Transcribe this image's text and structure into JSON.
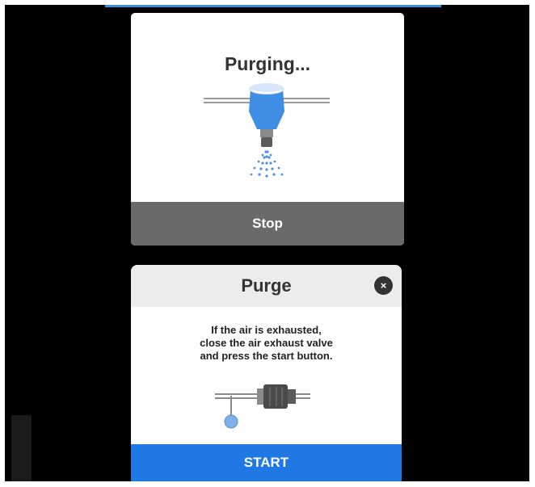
{
  "purging_dialog": {
    "title": "Purging...",
    "stop_label": "Stop",
    "icon": "spray-nozzle-icon"
  },
  "purge_dialog": {
    "title": "Purge",
    "close_glyph": "×",
    "message_lines": [
      "If the air is exhausted,",
      "close the air exhaust valve",
      "and press the start button."
    ],
    "icon": "air-exhaust-valve-icon",
    "start_label": "START"
  },
  "colors": {
    "background": "#000000",
    "accent_blue": "#1f78e3",
    "stop_gray": "#6a6a6a",
    "header_gray": "#ececec",
    "ink_blue": "#3f8ee6"
  }
}
